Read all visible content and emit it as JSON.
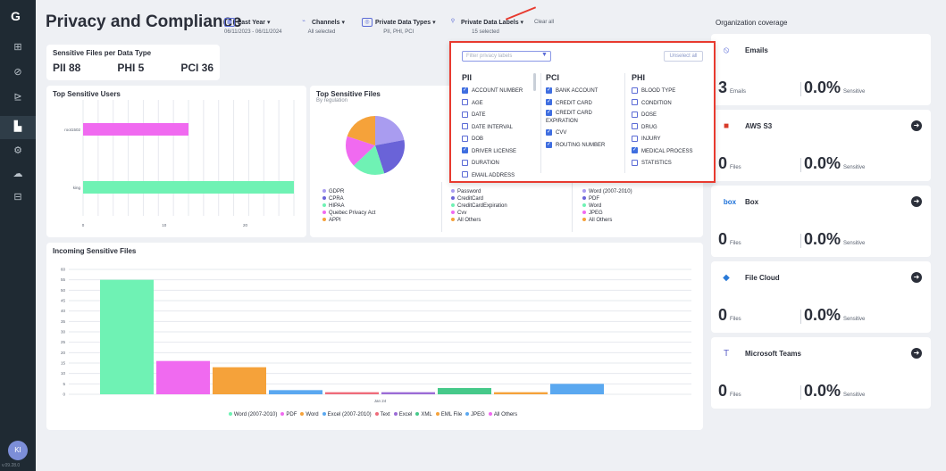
{
  "app": {
    "title": "Privacy and Compliance",
    "version": "v.09.28.0"
  },
  "sidebar": {
    "logo": "G",
    "items": [
      {
        "icon": "grid-icon",
        "glyph": "⊞"
      },
      {
        "icon": "shield-icon",
        "glyph": "⊘"
      },
      {
        "icon": "tree-icon",
        "glyph": "⊵"
      },
      {
        "icon": "chart-icon",
        "glyph": "▙"
      },
      {
        "icon": "gear-icon",
        "glyph": "⚙"
      },
      {
        "icon": "cloud-icon",
        "glyph": "☁"
      },
      {
        "icon": "report-icon",
        "glyph": "⊟"
      }
    ],
    "avatar": "KI"
  },
  "filters": {
    "date": {
      "label": "Last Year",
      "sub": "06/11/2023 - 06/11/2024"
    },
    "channels": {
      "label": "Channels",
      "sub": "All selected"
    },
    "types": {
      "label": "Private Data Types",
      "sub": "PII, PHI, PCI"
    },
    "labels": {
      "label": "Private Data Labels",
      "sub": "15 selected"
    },
    "clear_all": "Clear all"
  },
  "sensitive_files": {
    "title": "Sensitive Files per Data Type",
    "pii": "PII 88",
    "phi": "PHI 5",
    "pci": "PCI 36"
  },
  "top_users": {
    "title": "Top Sensitive Users",
    "users": [
      "root1502",
      "king"
    ],
    "ticks": [
      "0",
      "10",
      "20"
    ],
    "colors": [
      "#f06af0",
      "#6ff2b4"
    ]
  },
  "top_files": {
    "title": "Top Sensitive Files",
    "subtitle": "By regulation",
    "legend1": [
      "GDPR",
      "CPRA",
      "HIPAA",
      "Quebec Privacy Act",
      "APPI"
    ],
    "legend1_colors": [
      "#a99cf0",
      "#6a63d8",
      "#6ff2b4",
      "#f06af0",
      "#f5a23a"
    ],
    "legend2": [
      "Password",
      "CreditCard",
      "CreditCardExpiration",
      "Cvv",
      "All Others"
    ],
    "legend2_colors": [
      "#a99cf0",
      "#6a63d8",
      "#6ff2b4",
      "#f06af0",
      "#f5a23a"
    ],
    "legend3": [
      "Word (2007-2010)",
      "PDF",
      "Word",
      "JPEG",
      "All Others"
    ],
    "legend3_colors": [
      "#a99cf0",
      "#6a63d8",
      "#6ff2b4",
      "#f06af0",
      "#f5a23a"
    ]
  },
  "incoming": {
    "title": "Incoming Sensitive Files",
    "xlabel": "Jan 24"
  },
  "chart_data": [
    {
      "type": "bar",
      "title": "Top Sensitive Users",
      "categories": [
        "root1502",
        "king"
      ],
      "values": [
        13,
        26
      ],
      "xlim": [
        0,
        26
      ]
    },
    {
      "type": "pie",
      "title": "Top Sensitive Files",
      "categories": [
        "GDPR",
        "CPRA",
        "HIPAA",
        "Quebec Privacy Act",
        "APPI"
      ],
      "values": [
        22,
        23,
        18,
        17,
        20
      ],
      "colors": [
        "#a99cf0",
        "#6a63d8",
        "#6ff2b4",
        "#f06af0",
        "#f5a23a"
      ]
    },
    {
      "type": "bar",
      "title": "Incoming Sensitive Files",
      "categories": [
        "Word (2007-2010)",
        "PDF",
        "Word",
        "Excel (2007-2010)",
        "Text",
        "Excel",
        "XML",
        "EML File",
        "JPEG",
        "All Others"
      ],
      "values": [
        55,
        16,
        13,
        2,
        1,
        1,
        3,
        1,
        5,
        0
      ],
      "colors": [
        "#6ff2b4",
        "#f06af0",
        "#f5a23a",
        "#5aa8f0",
        "#ef6b7a",
        "#9b6bd6",
        "#46c98a",
        "#f5a23a",
        "#5aa8f0",
        "#f06af0"
      ],
      "yticks": [
        "0",
        "5",
        "10",
        "15",
        "20",
        "25",
        "30",
        "35",
        "40",
        "45",
        "50",
        "55",
        "60"
      ],
      "ylim": [
        0,
        60
      ]
    }
  ],
  "coverage": {
    "title": "Organization coverage",
    "items": [
      {
        "name": "Emails",
        "count": "3",
        "unit": "Emails",
        "pct": "0.0%",
        "pct_unit": "Sensitive",
        "arrow": false,
        "icon": "email-icon",
        "glyph": "⦸",
        "color": "#5a6ad8"
      },
      {
        "name": "AWS S3",
        "count": "0",
        "unit": "Files",
        "pct": "0.0%",
        "pct_unit": "Sensitive",
        "arrow": true,
        "icon": "aws-icon",
        "glyph": "■",
        "color": "#d83b2a"
      },
      {
        "name": "Box",
        "count": "0",
        "unit": "Files",
        "pct": "0.0%",
        "pct_unit": "Sensitive",
        "arrow": true,
        "icon": "box-icon",
        "glyph": "box",
        "color": "#1a6fd8"
      },
      {
        "name": "File Cloud",
        "count": "0",
        "unit": "Files",
        "pct": "0.0%",
        "pct_unit": "Sensitive",
        "arrow": true,
        "icon": "filecloud-icon",
        "glyph": "◆",
        "color": "#2a7ad8"
      },
      {
        "name": "Microsoft Teams",
        "count": "0",
        "unit": "Files",
        "pct": "0.0%",
        "pct_unit": "Sensitive",
        "arrow": true,
        "icon": "teams-icon",
        "glyph": "T",
        "color": "#5b5fc7"
      }
    ]
  },
  "dropdown": {
    "placeholder": "Filter privacy labels",
    "unselect": "Unselect all",
    "columns": [
      {
        "title": "PII",
        "options": [
          {
            "label": "ACCOUNT NUMBER",
            "checked": true
          },
          {
            "label": "AGE",
            "checked": false
          },
          {
            "label": "DATE",
            "checked": false
          },
          {
            "label": "DATE INTERVAL",
            "checked": false
          },
          {
            "label": "DOB",
            "checked": false
          },
          {
            "label": "DRIVER LICENSE",
            "checked": true
          },
          {
            "label": "DURATION",
            "checked": false
          },
          {
            "label": "EMAIL ADDRESS",
            "checked": false
          }
        ]
      },
      {
        "title": "PCI",
        "options": [
          {
            "label": "BANK ACCOUNT",
            "checked": true
          },
          {
            "label": "CREDIT CARD",
            "checked": true
          },
          {
            "label": "CREDIT CARD EXPIRATION",
            "checked": true
          },
          {
            "label": "CVV",
            "checked": true
          },
          {
            "label": "ROUTING NUMBER",
            "checked": true
          }
        ]
      },
      {
        "title": "PHI",
        "options": [
          {
            "label": "BLOOD TYPE",
            "checked": false
          },
          {
            "label": "CONDITION",
            "checked": false
          },
          {
            "label": "DOSE",
            "checked": false
          },
          {
            "label": "DRUG",
            "checked": false
          },
          {
            "label": "INJURY",
            "checked": false
          },
          {
            "label": "MEDICAL PROCESS",
            "checked": true
          },
          {
            "label": "STATISTICS",
            "checked": false
          }
        ]
      }
    ]
  }
}
